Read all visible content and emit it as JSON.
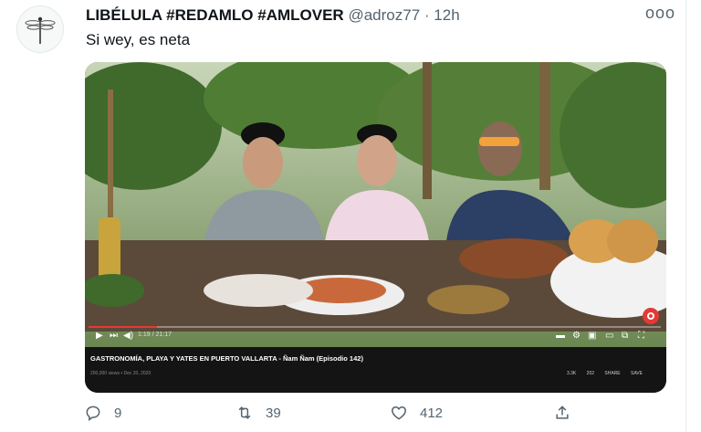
{
  "tweet": {
    "display_name": "LIBÉLULA #REDAMLO #AMLOVER",
    "handle": "@adroz77",
    "separator": "·",
    "time": "12h",
    "text": "Si wey, es neta",
    "more_label": "ooo"
  },
  "video": {
    "title": "GASTRONOMÍA, PLAYA Y YATES EN PUERTO VALLARTA - Ñam Ñam (Episodio 142)",
    "meta": "200,000 views • Dec 20, 2020",
    "time_readout": "1:19 / 21:17",
    "progress": 0.12,
    "actions": {
      "like": "3.3K",
      "dislike": "202",
      "share": "SHARE",
      "save": "SAVE"
    }
  },
  "actions": {
    "reply_count": "9",
    "retweet_count": "39",
    "like_count": "412"
  },
  "icons": {
    "avatar": "dragonfly-icon",
    "reply": "reply-icon",
    "retweet": "retweet-icon",
    "like": "heart-icon",
    "share": "share-icon"
  },
  "colors": {
    "text": "#0f1419",
    "secondary": "#536471",
    "progress": "#e53935"
  }
}
